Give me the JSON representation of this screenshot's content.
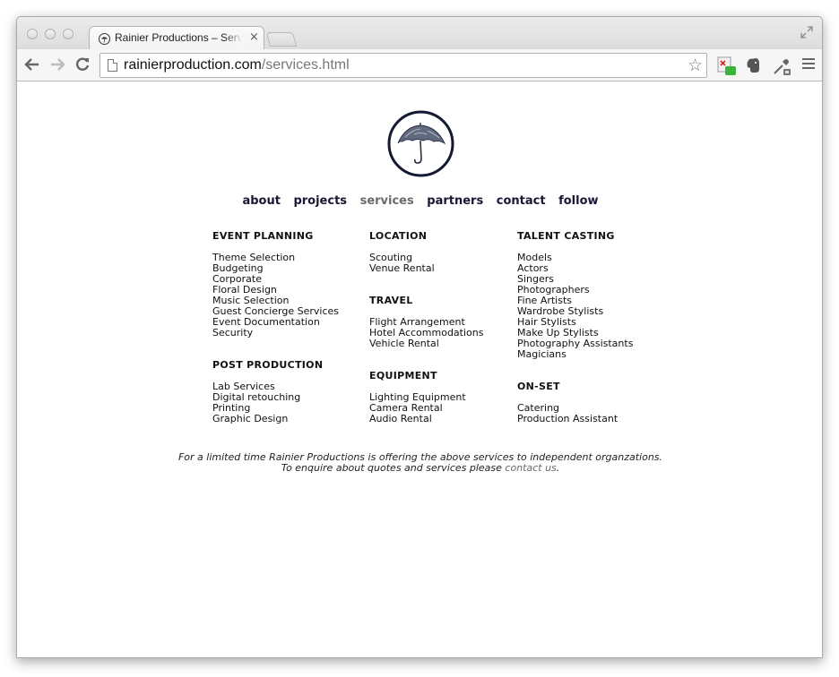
{
  "browser": {
    "tab_title": "Rainier Productions – Services",
    "tab_close": "×",
    "url_domain": "rainierproduction.com",
    "url_path": "/services.html"
  },
  "nav": {
    "about": "about",
    "projects": "projects",
    "services": "services",
    "partners": "partners",
    "contact": "contact",
    "follow": "follow"
  },
  "columns": [
    {
      "sections": [
        {
          "heading": "EVENT PLANNING",
          "items": [
            "Theme Selection",
            "Budgeting",
            "Corporate",
            "Floral Design",
            "Music Selection",
            "Guest Concierge Services",
            "Event Documentation",
            "Security"
          ]
        },
        {
          "heading": "POST PRODUCTION",
          "items": [
            "Lab Services",
            "Digital retouching",
            "Printing",
            "Graphic Design"
          ]
        }
      ]
    },
    {
      "sections": [
        {
          "heading": "LOCATION",
          "items": [
            "Scouting",
            "Venue Rental"
          ]
        },
        {
          "heading": "TRAVEL",
          "items": [
            "Flight Arrangement",
            "Hotel Accommodations",
            "Vehicle Rental"
          ]
        },
        {
          "heading": "EQUIPMENT",
          "items": [
            "Lighting Equipment",
            "Camera Rental",
            "Audio Rental"
          ]
        }
      ]
    },
    {
      "sections": [
        {
          "heading": "TALENT CASTING",
          "items": [
            "Models",
            "Actors",
            "Singers",
            "Photographers",
            "Fine Artists",
            "Wardrobe Stylists",
            "Hair Stylists",
            "Make Up Stylists",
            "Photography Assistants",
            "Magicians"
          ]
        },
        {
          "heading": "ON-SET",
          "items": [
            "Catering",
            "Production Assistant"
          ]
        }
      ]
    }
  ],
  "footer": {
    "line1": "For a limited time Rainier Productions is offering the above services to independent organzations.",
    "line2_prefix": "To enquire about quotes and services please",
    "link": "contact us",
    "line2_suffix": "."
  }
}
